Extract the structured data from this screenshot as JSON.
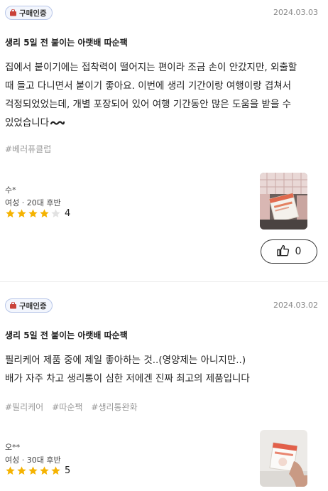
{
  "reviews": [
    {
      "badge": "구매인증",
      "date": "2024.03.03",
      "product": "생리 5일 전 붙이는 아랫배 따순팩",
      "body_lines": [
        "집에서 붙이기에는 접착력이 떨어지는 편이라 조금 손이 안갔지만, 외출할",
        "때 들고 다니면서 붙이기 좋아요. 이번에 생리 기간이랑 여행이랑 겹쳐서",
        "걱정되었었는데, 개별 포장되어 있어 여행 기간동안 많은 도움을 받을 수",
        "있었습니다"
      ],
      "tags": [
        "#베러퓨클럽"
      ],
      "author": "수*",
      "profile": "여성 · 20대 후반",
      "rating": 4,
      "rating_text": "4",
      "likes": "0"
    },
    {
      "badge": "구매인증",
      "date": "2024.03.02",
      "product": "생리 5일 전 붙이는 아랫배 따순팩",
      "body_lines": [
        "필리케어 제품 중에 제일 좋아하는 것..(영양제는 아니지만..)",
        "배가 자주 차고 생리통이 심한 저에겐 진짜 최고의 제품입니다"
      ],
      "tags": [
        "#필리케어",
        "#따순팩",
        "#생리통완화"
      ],
      "author": "오**",
      "profile": "여성 · 30대 후반",
      "rating": 5,
      "rating_text": "5"
    }
  ],
  "colors": {
    "star_filled": "#f5b301",
    "star_empty": "#e2e2e2",
    "badge_border": "#b8c6e8",
    "badge_bg": "#f3f6fd",
    "bag_icon": "#c9423a"
  },
  "icons": [
    "shopping-bag-icon",
    "star-icon",
    "thumbs-up-icon",
    "wavy-emoji-icon"
  ]
}
